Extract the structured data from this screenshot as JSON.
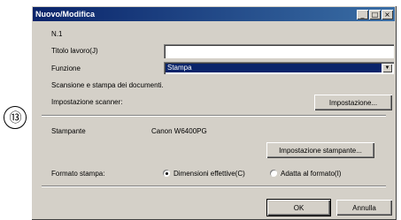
{
  "step_marker": "⑬",
  "window": {
    "title": "Nuovo/Modifica",
    "minimize": "_",
    "maximize": "□",
    "close": "×"
  },
  "form": {
    "job_number": "N.1",
    "job_title_label": "Titolo lavoro(J)",
    "job_title_value": "",
    "function_label": "Funzione",
    "function_value": "Stampa",
    "function_description": "Scansione e stampa dei documenti.",
    "scanner_settings_label": "Impostazione scanner:",
    "scanner_settings_button": "Impostazione...",
    "printer_label": "Stampante",
    "printer_value": "Canon W6400PG",
    "printer_settings_button": "Impostazione stampante...",
    "print_format_label": "Formato stampa:",
    "option_actual_size": "Dimensioni effettive(C)",
    "option_fit_format": "Adatta al formato(I)",
    "selected_option": "Dimensioni effettive(C)"
  },
  "footer": {
    "ok_button": "OK",
    "cancel_button": "Annulla"
  }
}
